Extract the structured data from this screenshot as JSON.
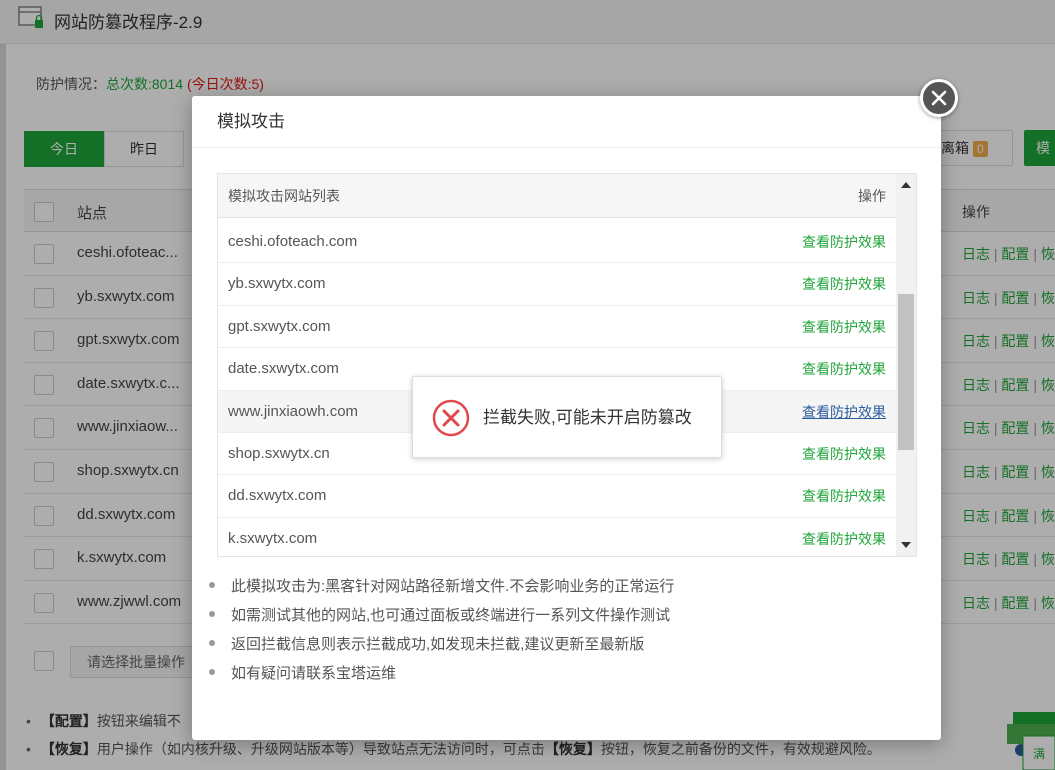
{
  "app": {
    "title": "网站防篡改程序-2.9"
  },
  "stats": {
    "label": "防护情况：",
    "total": "总次数:8014",
    "today": "(今日次数:5)"
  },
  "tabs": [
    {
      "label": "今日",
      "active": true
    },
    {
      "label": "昨日",
      "active": false
    }
  ],
  "toolbar": {
    "isolation_label": "离箱",
    "isolation_count": "0",
    "green_button_partial": "模"
  },
  "table": {
    "headers": {
      "site": "站点",
      "ops": "操作"
    },
    "rows": [
      {
        "site": "ceshi.ofoteac..."
      },
      {
        "site": "yb.sxwytx.com"
      },
      {
        "site": "gpt.sxwytx.com"
      },
      {
        "site": "date.sxwytx.c..."
      },
      {
        "site": "www.jinxiaow..."
      },
      {
        "site": "shop.sxwytx.cn"
      },
      {
        "site": "dd.sxwytx.com"
      },
      {
        "site": "k.sxwytx.com"
      },
      {
        "site": "www.zjwwl.com"
      }
    ],
    "ops": {
      "log": "日志",
      "config": "配置",
      "restore_partial": "恢",
      "sep": "|"
    }
  },
  "batch": {
    "placeholder": "请选择批量操作"
  },
  "notes": {
    "config_key": "【配置】",
    "config_text": "按钮来编辑不",
    "restore_key": "【恢复】",
    "restore_text": "用户操作（如内核升级、升级网站版本等）导致站点无法访问时，可点击",
    "restore_key2": "【恢复】",
    "restore_text2": "按钮，恢复之前备份的文件，有效规避风险。"
  },
  "corner_widget": {
    "label": "满"
  },
  "modal": {
    "title": "模拟攻击",
    "list_header": "模拟攻击网站列表",
    "action_header": "操作",
    "rows": [
      {
        "site": "ceshi.ofoteach.com",
        "action": "查看防护效果"
      },
      {
        "site": "yb.sxwytx.com",
        "action": "查看防护效果"
      },
      {
        "site": "gpt.sxwytx.com",
        "action": "查看防护效果"
      },
      {
        "site": "date.sxwytx.com",
        "action": "查看防护效果"
      },
      {
        "site": "www.jinxiaowh.com",
        "action": "查看防护效果"
      },
      {
        "site": "shop.sxwytx.cn",
        "action": "查看防护效果"
      },
      {
        "site": "dd.sxwytx.com",
        "action": "查看防护效果"
      },
      {
        "site": "k.sxwytx.com",
        "action": "查看防护效果"
      }
    ],
    "tips": [
      "此模拟攻击为:黑客针对网站路径新增文件.不会影响业务的正常运行",
      "如需测试其他的网站,也可通过面板或终端进行一系列文件操作测试",
      "返回拦截信息则表示拦截成功,如发现未拦截,建议更新至最新版",
      "如有疑问请联系宝塔运维"
    ]
  },
  "toast": {
    "message": "拦截失败,可能未开启防篡改",
    "icon": "error-circle-icon"
  },
  "colors": {
    "accent": "#20a53a",
    "danger": "#e01a1a",
    "link_hover": "#2c5c9f"
  }
}
